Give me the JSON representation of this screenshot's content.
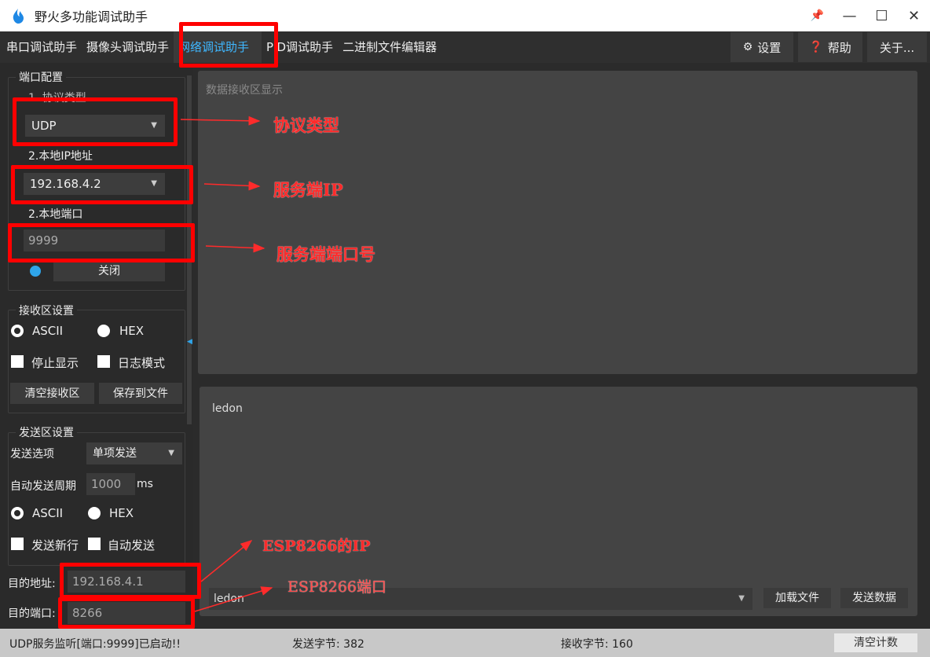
{
  "window": {
    "title": "野火多功能调试助手",
    "controls": {
      "pin": "📌",
      "minimize": "—",
      "maximize": "☐",
      "close": "✕"
    }
  },
  "tabs": [
    {
      "label": "串口调试助手"
    },
    {
      "label": "摄像头调试助手"
    },
    {
      "label": "网络调试助手"
    },
    {
      "label": "PID调试助手"
    },
    {
      "label": "二进制文件编辑器"
    }
  ],
  "toolbar": {
    "settings": "设置",
    "help": "帮助",
    "about": "关于..."
  },
  "port_config": {
    "group_title": "端口配置",
    "protocol_label": "1. 协议类型",
    "protocol_value": "UDP",
    "local_ip_label": "2.本地IP地址",
    "local_ip_value": "192.168.4.2",
    "local_port_label": "2.本地端口",
    "local_port_value": "9999",
    "toggle_button": "关闭"
  },
  "recv_settings": {
    "group_title": "接收区设置",
    "ascii": "ASCII",
    "hex": "HEX",
    "stop_display": "停止显示",
    "log_mode": "日志模式",
    "clear_button": "清空接收区",
    "save_button": "保存到文件"
  },
  "send_settings": {
    "group_title": "发送区设置",
    "send_option_label": "发送选项",
    "send_option_value": "单项发送",
    "auto_period_label": "自动发送周期",
    "auto_period_value": "1000",
    "auto_period_unit": "ms",
    "ascii": "ASCII",
    "hex": "HEX",
    "newline": "发送新行",
    "auto_send": "自动发送"
  },
  "target": {
    "addr_label": "目的地址:",
    "addr_value": "192.168.4.1",
    "port_label": "目的端口:",
    "port_value": "8266"
  },
  "recv_area": {
    "placeholder": "数据接收区显示"
  },
  "send_area": {
    "text": "ledon"
  },
  "send_bar": {
    "combo_value": "ledon",
    "load_file": "加载文件",
    "send_data": "发送数据"
  },
  "status": {
    "message": "UDP服务监听[端口:9999]已启动!!",
    "sent_bytes": "发送字节: 382",
    "recv_bytes": "接收字节: 160",
    "clear_count": "清空计数"
  },
  "annotations": {
    "protocol": "协议类型",
    "server_ip": "服务端IP",
    "server_port": "服务端端口号",
    "esp_ip": "ESP8266的IP",
    "esp_port": "ESP8266端口"
  },
  "colors": {
    "highlight": "#ff0000",
    "accent": "#3fb7ff"
  }
}
